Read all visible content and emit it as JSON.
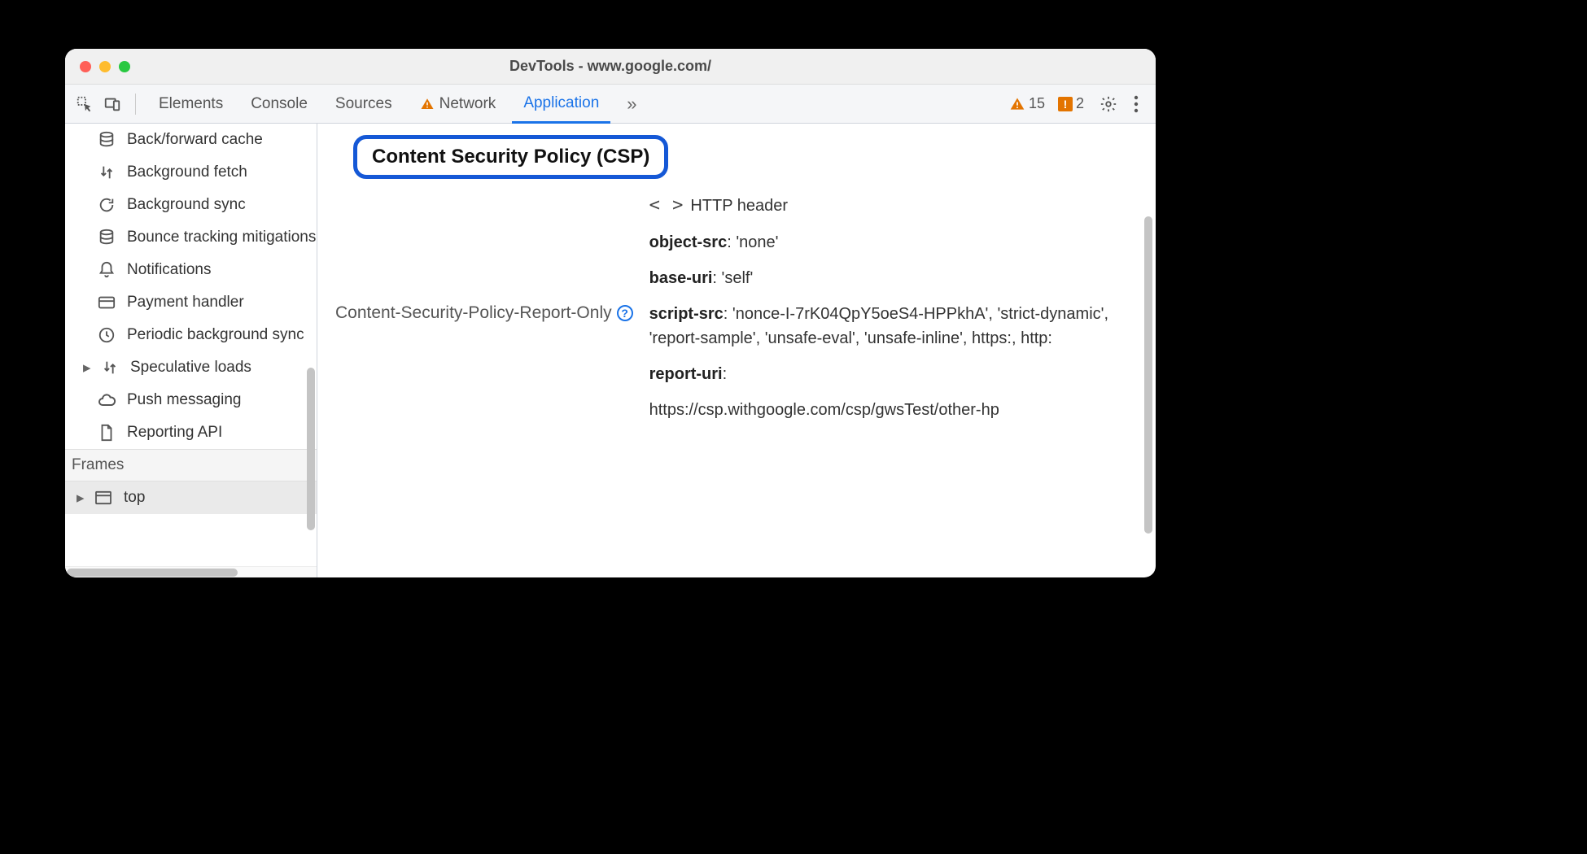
{
  "window": {
    "title": "DevTools - www.google.com/"
  },
  "toolbar": {
    "tabs": [
      "Elements",
      "Console",
      "Sources",
      "Network",
      "Application"
    ],
    "active_tab_index": 4,
    "network_has_warning": true,
    "warnings_count": "15",
    "issues_count": "2"
  },
  "sidebar": {
    "items": [
      {
        "label": "Back/forward cache",
        "icon": "database"
      },
      {
        "label": "Background fetch",
        "icon": "sync-arrows"
      },
      {
        "label": "Background sync",
        "icon": "refresh"
      },
      {
        "label": "Bounce tracking mitigations",
        "icon": "database"
      },
      {
        "label": "Notifications",
        "icon": "bell"
      },
      {
        "label": "Payment handler",
        "icon": "card"
      },
      {
        "label": "Periodic background sync",
        "icon": "clock"
      },
      {
        "label": "Speculative loads",
        "icon": "sync-arrows",
        "expandable": true
      },
      {
        "label": "Push messaging",
        "icon": "cloud"
      },
      {
        "label": "Reporting API",
        "icon": "file"
      }
    ],
    "frames": {
      "header": "Frames",
      "top_label": "top"
    }
  },
  "main": {
    "heading": "Content Security Policy (CSP)",
    "policy_label": "Content-Security-Policy-Report-Only",
    "source_label": "HTTP header",
    "directives": [
      {
        "name": "object-src",
        "value": "'none'"
      },
      {
        "name": "base-uri",
        "value": "'self'"
      },
      {
        "name": "script-src",
        "value": "'nonce-I-7rK04QpY5oeS4-HPPkhA', 'strict-dynamic', 'report-sample', 'unsafe-eval', 'unsafe-inline', https:, http:"
      },
      {
        "name": "report-uri",
        "value": "https://csp.withgoogle.com/csp/gwsTest/other-hp"
      }
    ]
  }
}
